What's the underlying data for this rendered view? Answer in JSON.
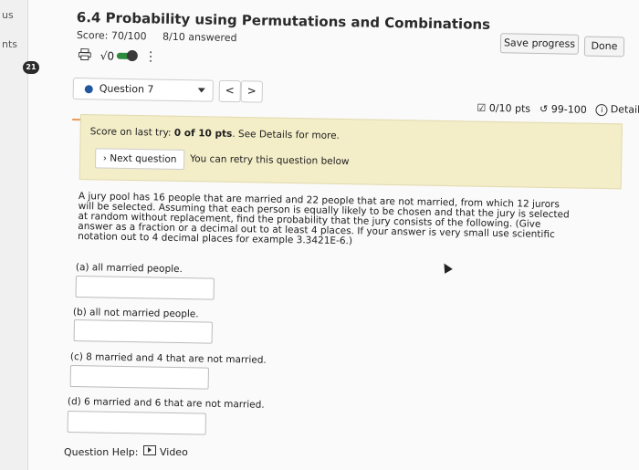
{
  "sidebar": {
    "frag1": "us",
    "frag2": "nts",
    "badge": "21"
  },
  "header": {
    "title": "6.4 Probability using Permutations and Combinations",
    "score": "Score: 70/100",
    "answered": "8/10 answered",
    "sqrt_label": "√0",
    "save_label": "Save progress",
    "done_label": "Done"
  },
  "question_bar": {
    "selected": "Question 7",
    "prev": "<",
    "next": ">",
    "points": "0/10 pts",
    "attempts": "99-100",
    "details": "Details"
  },
  "retry": {
    "score_prefix": "Score on last try: ",
    "score_value": "0 of 10 pts",
    "score_suffix": ". See Details for more.",
    "next_button": "› Next question",
    "message": "You can retry this question below"
  },
  "problem": {
    "text": "A jury pool has 16 people that are married and 22 people that are not married, from which 12 jurors will be selected. Assuming that each person is equally likely to be chosen and that the jury is selected at random without replacement, find the probability that the jury consists of the following. (Give answer as a fraction or a decimal out to at least 4 places. If your answer is very small use scientific notation out to 4 decimal places for example 3.3421E-6.)",
    "parts": [
      "(a) all married people.",
      "(b) all not married people.",
      "(c) 8 married and 4 that are not married.",
      "(d) 6 married and 6 that are not married."
    ]
  },
  "help": {
    "label": "Question Help:",
    "video": "Video"
  },
  "colors": {
    "accent_orange": "#e89a5a",
    "retry_bg": "#f3edc8",
    "toggle_green": "#2e8b3e",
    "question_dot": "#2256a0"
  }
}
